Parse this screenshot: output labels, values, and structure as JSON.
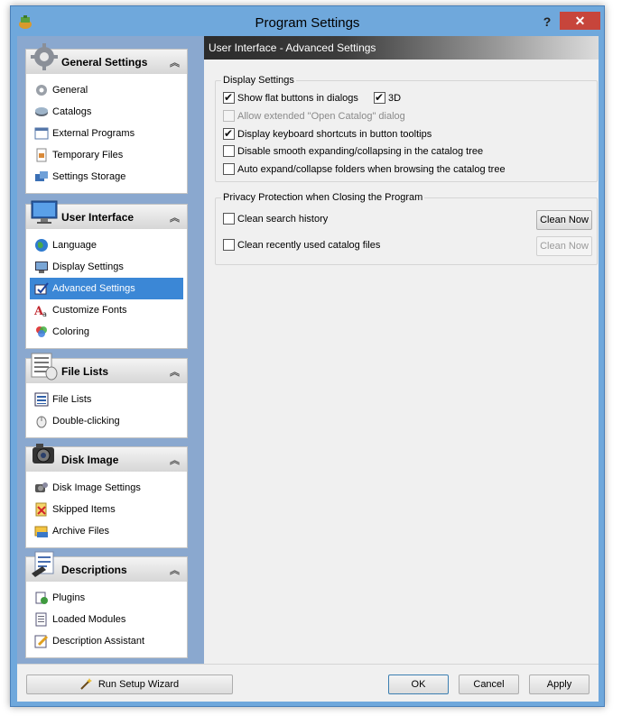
{
  "window": {
    "title": "Program Settings",
    "help_label": "?",
    "close_label": "✕"
  },
  "sidebar": {
    "groups": [
      {
        "title": "General Settings",
        "icon": "gear-icon",
        "items": [
          {
            "label": "General",
            "icon": "gear-small-icon"
          },
          {
            "label": "Catalogs",
            "icon": "disk-icon"
          },
          {
            "label": "External Programs",
            "icon": "program-icon"
          },
          {
            "label": "Temporary Files",
            "icon": "temp-file-icon"
          },
          {
            "label": "Settings Storage",
            "icon": "storage-icon"
          }
        ]
      },
      {
        "title": "User Interface",
        "icon": "monitor-icon",
        "items": [
          {
            "label": "Language",
            "icon": "globe-icon"
          },
          {
            "label": "Display Settings",
            "icon": "display-icon"
          },
          {
            "label": "Advanced Settings",
            "icon": "advanced-icon",
            "active": true
          },
          {
            "label": "Customize Fonts",
            "icon": "font-icon"
          },
          {
            "label": "Coloring",
            "icon": "color-icon"
          }
        ]
      },
      {
        "title": "File Lists",
        "icon": "file-list-icon",
        "items": [
          {
            "label": "File Lists",
            "icon": "list-icon"
          },
          {
            "label": "Double-clicking",
            "icon": "mouse-icon"
          }
        ]
      },
      {
        "title": "Disk Image",
        "icon": "camera-icon",
        "items": [
          {
            "label": "Disk Image Settings",
            "icon": "disk-image-icon"
          },
          {
            "label": "Skipped Items",
            "icon": "skip-icon"
          },
          {
            "label": "Archive Files",
            "icon": "archive-icon"
          }
        ]
      },
      {
        "title": "Descriptions",
        "icon": "description-icon",
        "items": [
          {
            "label": "Plugins",
            "icon": "plugin-icon"
          },
          {
            "label": "Loaded Modules",
            "icon": "module-icon"
          },
          {
            "label": "Description Assistant",
            "icon": "assistant-icon"
          }
        ]
      }
    ]
  },
  "panel": {
    "title": "User Interface - Advanced Settings",
    "display_settings": {
      "legend": "Display Settings",
      "options": [
        {
          "label": "Show flat buttons in dialogs",
          "checked": true,
          "disabled": false
        },
        {
          "label": "3D",
          "checked": true,
          "disabled": false
        },
        {
          "label": "Allow extended \"Open Catalog\" dialog",
          "checked": false,
          "disabled": true
        },
        {
          "label": "Display keyboard shortcuts in button tooltips",
          "checked": true,
          "disabled": false
        },
        {
          "label": "Disable smooth expanding/collapsing in the catalog tree",
          "checked": false,
          "disabled": false
        },
        {
          "label": "Auto expand/collapse folders when browsing the catalog tree",
          "checked": false,
          "disabled": false
        }
      ]
    },
    "privacy": {
      "legend": "Privacy Protection when Closing the Program",
      "options": [
        {
          "label": "Clean search history",
          "checked": false,
          "button": "Clean Now",
          "button_disabled": false
        },
        {
          "label": "Clean recently used catalog files",
          "checked": false,
          "button": "Clean Now",
          "button_disabled": true
        }
      ]
    }
  },
  "footer": {
    "wizard_label": "Run Setup Wizard",
    "ok_label": "OK",
    "cancel_label": "Cancel",
    "apply_label": "Apply"
  }
}
